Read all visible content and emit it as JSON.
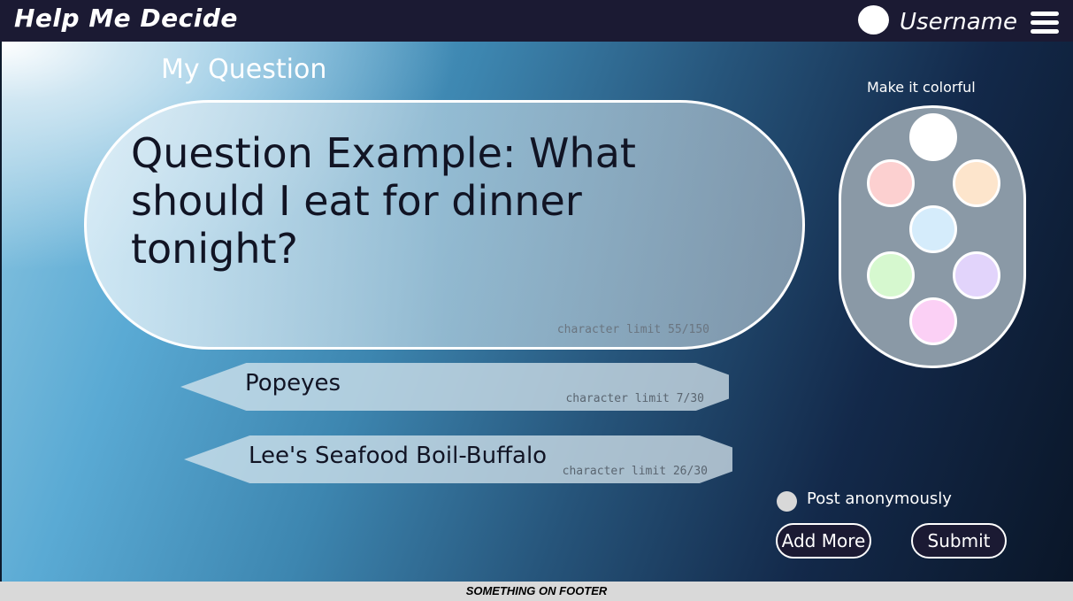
{
  "header": {
    "app_title": "Help Me Decide",
    "username": "Username"
  },
  "question": {
    "heading": "My Question",
    "text": "Question Example: What should I eat for dinner tonight?",
    "char_limit": "character limit 55/150"
  },
  "options": [
    {
      "text": "Popeyes",
      "char_limit": "character limit 7/30"
    },
    {
      "text": "Lee's Seafood Boil-Buffalo",
      "char_limit": "character limit 26/30"
    }
  ],
  "palette": {
    "title": "Make it colorful",
    "colors": [
      "#ffffff",
      "#fcd0d0",
      "#fde5cc",
      "#d5ecfb",
      "#d6f8cf",
      "#e2d4fb",
      "#fbd0f5"
    ]
  },
  "anonymous": {
    "label": "Post anonymously",
    "checked": false
  },
  "actions": {
    "add_more": "Add More",
    "submit": "Submit"
  },
  "footer": {
    "text": "SOMETHING ON FOOTER"
  }
}
